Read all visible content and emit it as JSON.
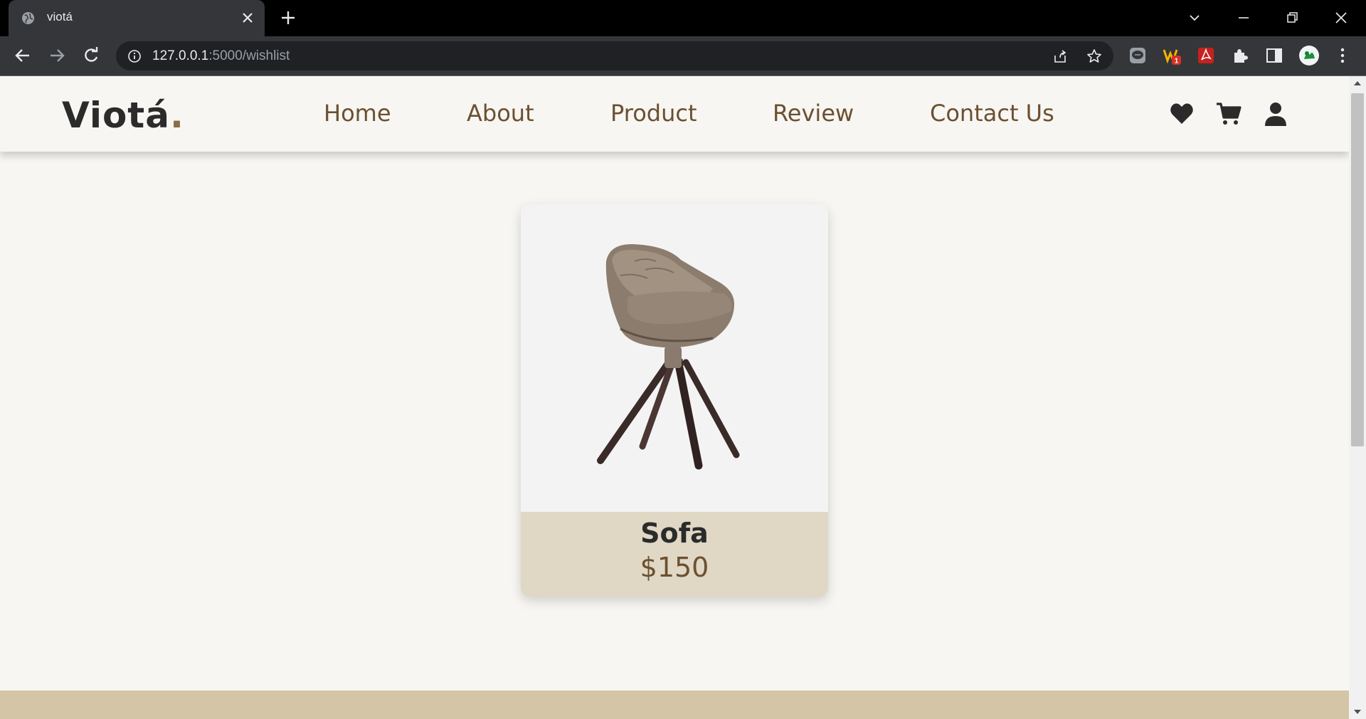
{
  "browser": {
    "tab_title": "viotá",
    "url_host": "127.0.0.1",
    "url_path": ":5000/wishlist",
    "extension_badge": "1"
  },
  "site": {
    "logo_text": "Viotá",
    "logo_dot": ".",
    "nav": [
      {
        "label": "Home"
      },
      {
        "label": "About"
      },
      {
        "label": "Product"
      },
      {
        "label": "Review"
      },
      {
        "label": "Contact Us"
      }
    ],
    "header_icons": [
      "heart-icon",
      "cart-icon",
      "user-icon"
    ]
  },
  "wishlist": {
    "items": [
      {
        "name": "Sofa",
        "price": "$150",
        "image": "chair-image"
      }
    ]
  },
  "colors": {
    "background": "#f7f6f2",
    "accent_brown": "#6b5031",
    "card_footer": "#e0d8c4",
    "footer_strip": "#d4c5a7"
  }
}
